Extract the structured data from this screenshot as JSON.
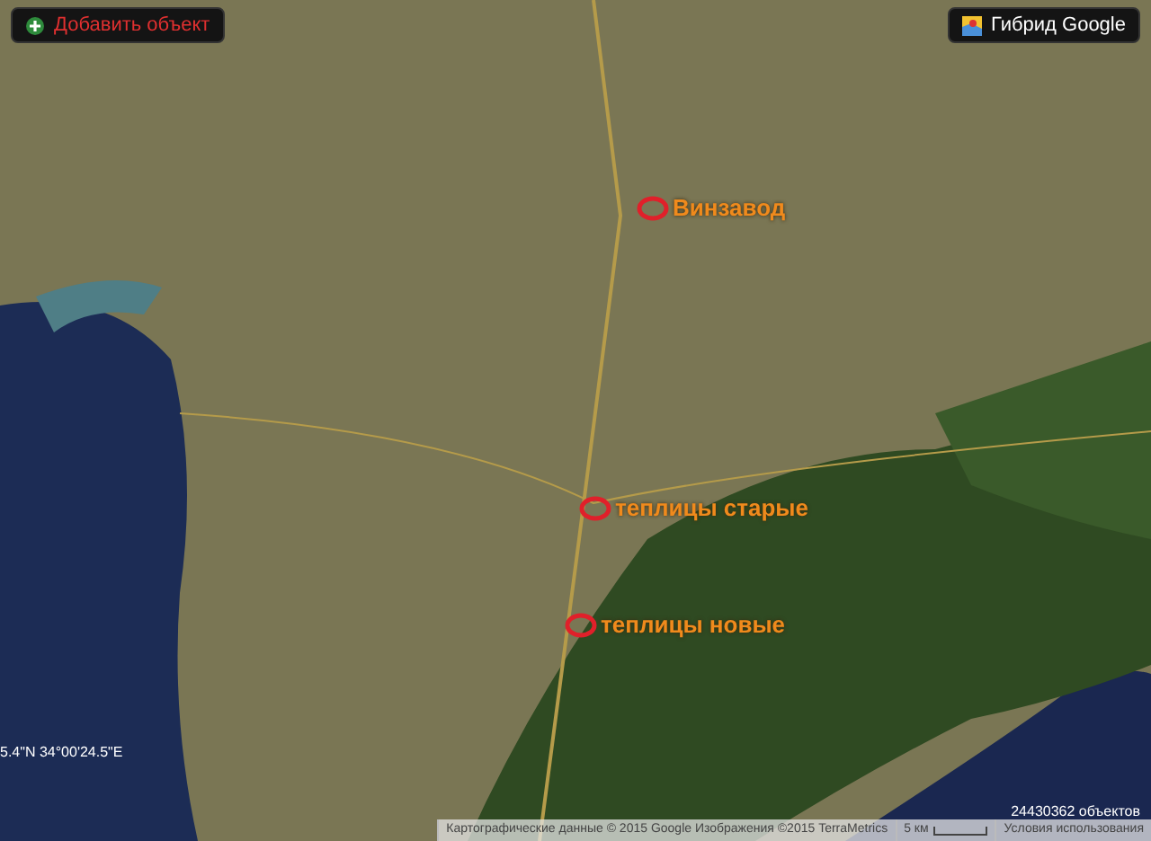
{
  "toolbar": {
    "add_button": "Добавить объект",
    "map_type_button": "Гибрид Google"
  },
  "markers": [
    {
      "label": "Винзавод"
    },
    {
      "label": "теплицы старые"
    },
    {
      "label": "теплицы новые"
    }
  ],
  "coordinates": "5.4\"N 34°00'24.5\"E",
  "object_count": "24430362 объектов",
  "attribution": {
    "data": "Картографические данные © 2015 Google Изображения ©2015 TerraMetrics",
    "scale": "5 км",
    "terms": "Условия использования"
  }
}
